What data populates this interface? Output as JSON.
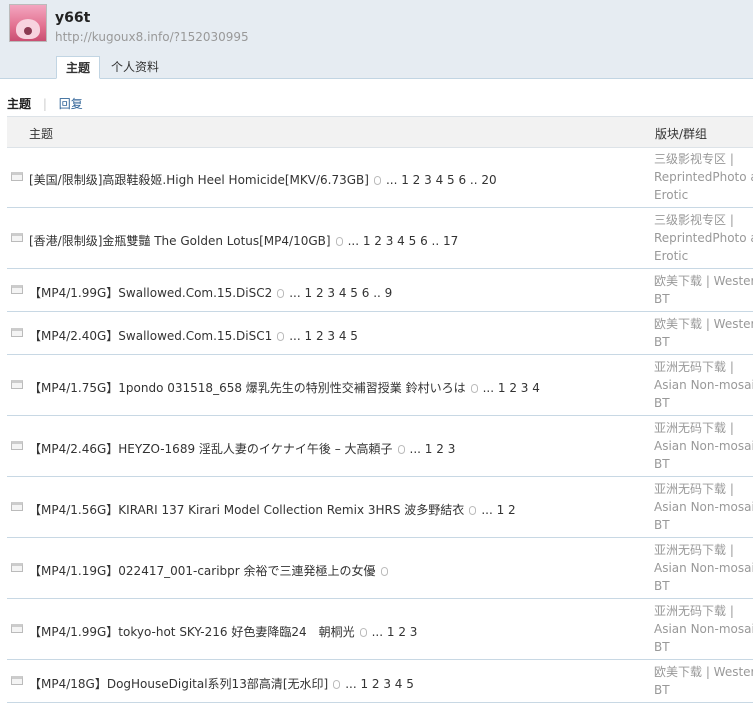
{
  "user": {
    "name": "y66t",
    "url": "http://kugoux8.info/?152030995"
  },
  "tabs": [
    {
      "label": "主题",
      "active": true
    },
    {
      "label": "个人资料",
      "active": false
    }
  ],
  "subnav": {
    "current": "主题",
    "link": "回复"
  },
  "table": {
    "headers": {
      "topic": "主题",
      "forum": "版块/群组"
    },
    "rows": [
      {
        "title": "[美国/限制级]高跟鞋殺姬.High Heel Homicide[MKV/6.73GB]",
        "attach": true,
        "pages": "... 1 2 3 4 5 6 .. 20",
        "forum": [
          "三级影视专区 |",
          "ReprintedPhoto and",
          "Erotic"
        ]
      },
      {
        "title": "[香港/限制级]金瓶雙豔 The Golden Lotus[MP4/10GB]",
        "attach": true,
        "pages": "... 1 2 3 4 5 6 .. 17",
        "forum": [
          "三级影视专区 |",
          "ReprintedPhoto and",
          "Erotic"
        ]
      },
      {
        "title": "【MP4/1.99G】Swallowed.Com.15.DiSC2",
        "attach": true,
        "pages": "... 1 2 3 4 5 6 .. 9",
        "forum": [
          "欧美下载 | Western",
          "BT"
        ]
      },
      {
        "title": "【MP4/2.40G】Swallowed.Com.15.DiSC1",
        "attach": true,
        "pages": "... 1 2 3 4 5",
        "forum": [
          "欧美下载 | Western",
          "BT"
        ]
      },
      {
        "title": "【MP4/1.75G】1pondo 031518_658 爆乳先生の特別性交補習授業 鈴村いろは",
        "attach": true,
        "pages": "... 1 2 3 4",
        "forum": [
          "亚洲无码下载 |",
          "Asian Non-mosaic",
          "BT"
        ]
      },
      {
        "title": "【MP4/2.46G】HEYZO-1689 淫乱人妻のイケナイ午後 – 大高頼子",
        "attach": true,
        "pages": "... 1 2 3",
        "forum": [
          "亚洲无码下载 |",
          "Asian Non-mosaic",
          "BT"
        ]
      },
      {
        "title": "【MP4/1.56G】KIRARI 137 Kirari Model Collection Remix 3HRS 波多野結衣",
        "attach": true,
        "pages": "... 1 2",
        "forum": [
          "亚洲无码下载 |",
          "Asian Non-mosaic",
          "BT"
        ]
      },
      {
        "title": "【MP4/1.19G】022417_001-caribpr 余裕で三連発極上の女優",
        "attach": true,
        "pages": "",
        "forum": [
          "亚洲无码下载 |",
          "Asian Non-mosaic",
          "BT"
        ]
      },
      {
        "title": "【MP4/1.99G】tokyo-hot SKY-216 好色妻降臨24　朝桐光",
        "attach": true,
        "pages": "... 1 2 3",
        "forum": [
          "亚洲无码下载 |",
          "Asian Non-mosaic",
          "BT"
        ]
      },
      {
        "title": "【MP4/18G】DogHouseDigital系列13部高清[无水印]",
        "attach": true,
        "pages": "... 1 2 3 4 5",
        "forum": [
          "欧美下载 | Western",
          "BT"
        ]
      }
    ]
  }
}
